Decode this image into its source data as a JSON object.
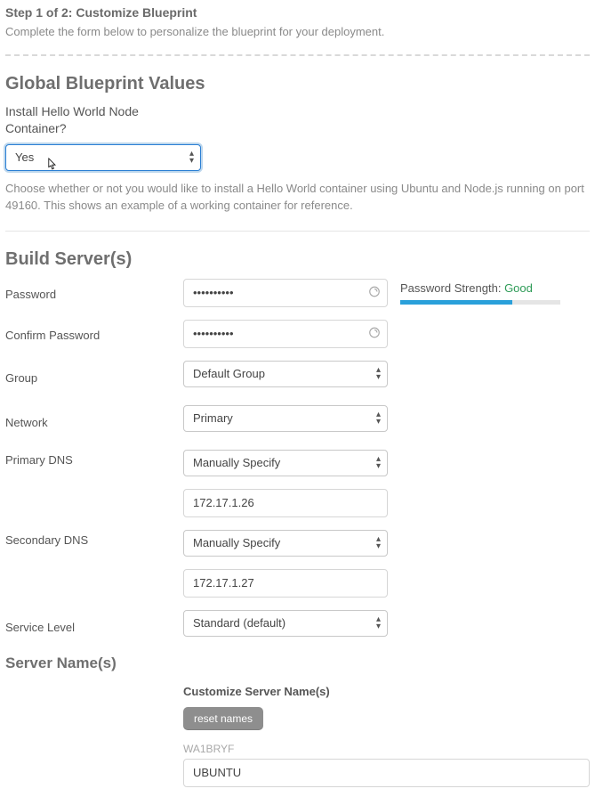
{
  "step": {
    "title": "Step 1 of 2: Customize Blueprint",
    "desc": "Complete the form below to personalize the blueprint for your deployment."
  },
  "global": {
    "heading": "Global Blueprint Values",
    "install_label": "Install Hello World Node Container?",
    "install_value": "Yes",
    "install_help": "Choose whether or not you would like to install a Hello World container using Ubuntu and Node.js running on port 49160. This shows an example of a working container for reference."
  },
  "build": {
    "heading": "Build Server(s)",
    "password_label": "Password",
    "password_value": "••••••••••",
    "confirm_label": "Confirm Password",
    "confirm_value": "••••••••••",
    "strength_label": "Password Strength: ",
    "strength_word": "Good",
    "group_label": "Group",
    "group_value": "Default Group",
    "network_label": "Network",
    "network_value": "Primary",
    "primary_dns_label": "Primary DNS",
    "primary_dns_select": "Manually Specify",
    "primary_dns_value": "172.17.1.26",
    "secondary_dns_label": "Secondary DNS",
    "secondary_dns_select": "Manually Specify",
    "secondary_dns_value": "172.17.1.27",
    "service_level_label": "Service Level",
    "service_level_value": "Standard (default)"
  },
  "server_names": {
    "heading": "Server Name(s)",
    "customize_label": "Customize Server Name(s)",
    "reset_label": "reset names",
    "prefix": "WA1BRYF",
    "name_value": "UBUNTU"
  }
}
